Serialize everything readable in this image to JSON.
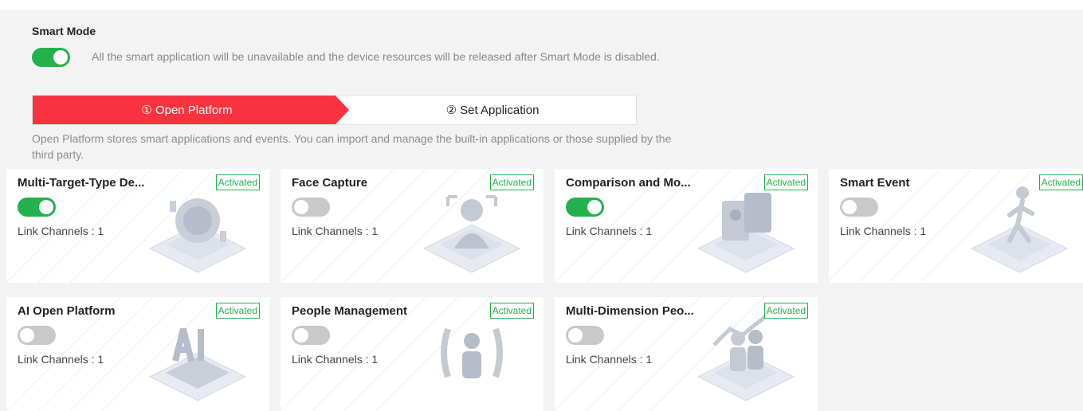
{
  "smart_mode": {
    "title": "Smart Mode",
    "enabled": true,
    "note": "All the smart application will be unavailable and the device resources will be released after Smart Mode is disabled."
  },
  "steps": {
    "step1": "① Open Platform",
    "step2": "② Set Application",
    "active_color": "#f8333f"
  },
  "description": "Open Platform stores smart applications and events. You can import and manage the built-in applications or those supplied by the third party.",
  "cards": [
    {
      "name": "Multi-Target-Type De...",
      "badge": "Activated",
      "enabled": true,
      "link": "Link Channels : 1",
      "icon": "face-scan-icon"
    },
    {
      "name": "Face Capture",
      "badge": "Activated",
      "enabled": false,
      "link": "Link Channels : 1",
      "icon": "face-capture-icon"
    },
    {
      "name": "Comparison and Mo...",
      "badge": "Activated",
      "enabled": true,
      "link": "Link Channels : 1",
      "icon": "id-comparison-icon"
    },
    {
      "name": "Smart Event",
      "badge": "Activated",
      "enabled": false,
      "link": "Link Channels : 1",
      "icon": "person-walking-icon"
    },
    {
      "name": "AI Open Platform",
      "badge": "Activated",
      "enabled": false,
      "link": "Link Channels : 1",
      "icon": "ai-chip-icon"
    },
    {
      "name": "People Management",
      "badge": "Activated",
      "enabled": false,
      "link": "Link Channels : 1",
      "icon": "people-management-icon"
    },
    {
      "name": "Multi-Dimension Peo...",
      "badge": "Activated",
      "enabled": false,
      "link": "Link Channels : 1",
      "icon": "people-statistics-icon"
    }
  ],
  "colors": {
    "accent_green": "#22b14c",
    "toggle_off": "#c9c9c9",
    "background": "#f3f3f3"
  }
}
